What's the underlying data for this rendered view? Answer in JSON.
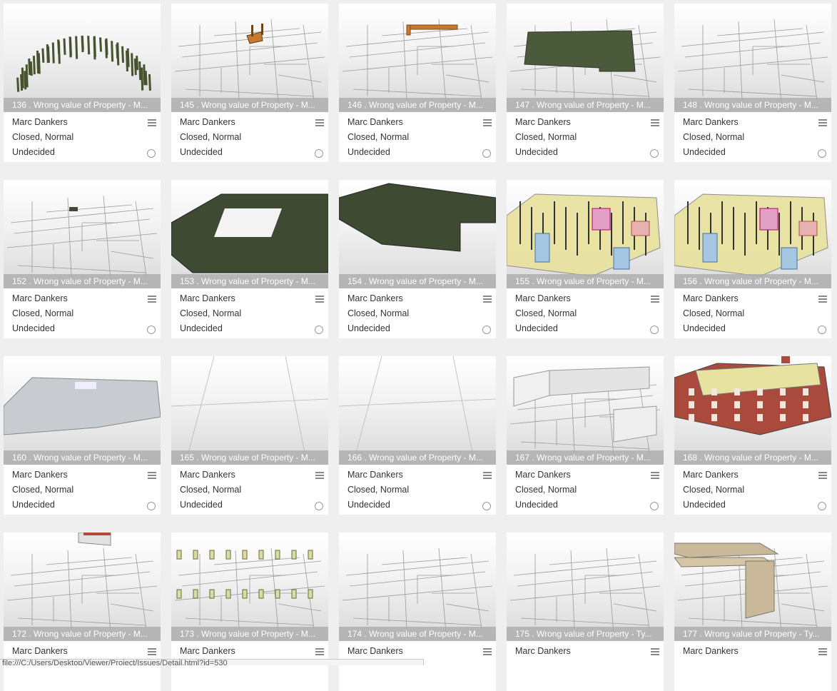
{
  "cards": [
    {
      "caption": "136 . Wrong value of Property - M...",
      "author": "Marc Dankers",
      "status": "Closed, Normal",
      "decision": "Undecided",
      "thumb": "posts"
    },
    {
      "caption": "145 . Wrong value of Property - M...",
      "author": "Marc Dankers",
      "status": "Closed, Normal",
      "decision": "Undecided",
      "thumb": "plan-orange"
    },
    {
      "caption": "146 . Wrong value of Property - M...",
      "author": "Marc Dankers",
      "status": "Closed, Normal",
      "decision": "Undecided",
      "thumb": "plan-beam"
    },
    {
      "caption": "147 . Wrong value of Property - M...",
      "author": "Marc Dankers",
      "status": "Closed, Normal",
      "decision": "Undecided",
      "thumb": "plan-slab"
    },
    {
      "caption": "148 . Wrong value of Property - M...",
      "author": "Marc Dankers",
      "status": "Closed, Normal",
      "decision": "Undecided",
      "thumb": "plan"
    },
    {
      "caption": "152 . Wrong value of Property - M...",
      "author": "Marc Dankers",
      "status": "Closed, Normal",
      "decision": "Undecided",
      "thumb": "plan-dot"
    },
    {
      "caption": "153 . Wrong value of Property - M...",
      "author": "Marc Dankers",
      "status": "Closed, Normal",
      "decision": "Undecided",
      "thumb": "green-floor"
    },
    {
      "caption": "154 . Wrong value of Property - M...",
      "author": "Marc Dankers",
      "status": "Closed, Normal",
      "decision": "Undecided",
      "thumb": "green-roof"
    },
    {
      "caption": "155 . Wrong value of Property - M...",
      "author": "Marc Dankers",
      "status": "Closed, Normal",
      "decision": "Undecided",
      "thumb": "yellow-model"
    },
    {
      "caption": "156 . Wrong value of Property - M...",
      "author": "Marc Dankers",
      "status": "Closed, Normal",
      "decision": "Undecided",
      "thumb": "yellow-model"
    },
    {
      "caption": "160 . Wrong value of Property - M...",
      "author": "Marc Dankers",
      "status": "Closed, Normal",
      "decision": "Undecided",
      "thumb": "grey-floor"
    },
    {
      "caption": "165 . Wrong value of Property - M...",
      "author": "Marc Dankers",
      "status": "Closed, Normal",
      "decision": "Undecided",
      "thumb": "empty"
    },
    {
      "caption": "166 . Wrong value of Property - M...",
      "author": "Marc Dankers",
      "status": "Closed, Normal",
      "decision": "Undecided",
      "thumb": "empty"
    },
    {
      "caption": "167 . Wrong value of Property - M...",
      "author": "Marc Dankers",
      "status": "Closed, Normal",
      "decision": "Undecided",
      "thumb": "white-walls"
    },
    {
      "caption": "168 . Wrong value of Property - M...",
      "author": "Marc Dankers",
      "status": "Closed, Normal",
      "decision": "Undecided",
      "thumb": "red-building"
    },
    {
      "caption": "172 . Wrong value of Property - M...",
      "author": "Marc Dankers",
      "status": "",
      "decision": "",
      "thumb": "small-box"
    },
    {
      "caption": "173 . Wrong value of Property - M...",
      "author": "Marc Dankers",
      "status": "",
      "decision": "",
      "thumb": "windows"
    },
    {
      "caption": "174 . Wrong value of Property - M...",
      "author": "Marc Dankers",
      "status": "",
      "decision": "",
      "thumb": "plan"
    },
    {
      "caption": "175 . Wrong value of Property - Ty...",
      "author": "Marc Dankers",
      "status": "",
      "decision": "",
      "thumb": "plan"
    },
    {
      "caption": "177 . Wrong value of Property - Ty...",
      "author": "Marc Dankers",
      "status": "",
      "decision": "",
      "thumb": "beige-wall"
    }
  ],
  "statusbar": {
    "url": "file:///C:/Users/Desktop/Viewer/Project/Issues/Detail.html?id=530"
  },
  "colors": {
    "caption_bg": "#aaaaaa",
    "green": "#3f4a33",
    "olive": "#4b5a3a",
    "orange": "#c87a30",
    "yellow": "#e8e2a0",
    "red": "#a94a3c",
    "beige": "#c9b99a"
  },
  "icons": {
    "menu": "menu-icon",
    "radio": "radio-icon"
  }
}
